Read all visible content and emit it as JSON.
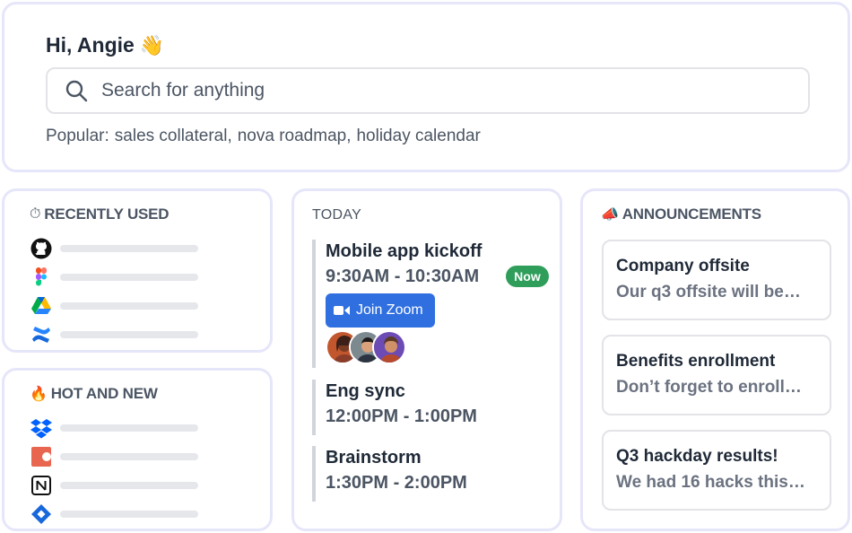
{
  "search": {
    "greeting": "Hi, Angie",
    "greeting_emoji": "👋",
    "placeholder": "Search for anything",
    "popular_label": "Popular:",
    "popular_links": [
      "sales collateral,",
      "nova roadmap,",
      "holiday calendar"
    ]
  },
  "recent": {
    "emoji": "⏱",
    "title": "RECENTLY USED",
    "apps": [
      "github-icon",
      "figma-icon",
      "google-drive-icon",
      "confluence-icon"
    ]
  },
  "hot": {
    "emoji": "🔥",
    "title": "HOT AND NEW",
    "apps": [
      "dropbox-icon",
      "craft-icon",
      "notion-icon",
      "jira-icon"
    ]
  },
  "today": {
    "title": "TODAY",
    "events": [
      {
        "title": "Mobile app kickoff",
        "time": "9:30AM - 10:30AM",
        "badge": "Now",
        "join_label": "Join Zoom"
      },
      {
        "title": "Eng sync",
        "time": "12:00PM - 1:00PM"
      },
      {
        "title": "Brainstorm",
        "time": "1:30PM - 2:00PM"
      }
    ]
  },
  "announcements": {
    "emoji": "📣",
    "title": "ANNOUNCEMENTS",
    "items": [
      {
        "title": "Company offsite",
        "desc": "Our q3 offsite will be…"
      },
      {
        "title": "Benefits enrollment",
        "desc": "Don’t forget to enroll…"
      },
      {
        "title": "Q3 hackday results!",
        "desc": "We had 16 hacks this…"
      }
    ]
  },
  "colors": {
    "card_border": "#e6e6fa",
    "now_badge": "#2f9e5b",
    "zoom_button": "#2f6fe0"
  }
}
